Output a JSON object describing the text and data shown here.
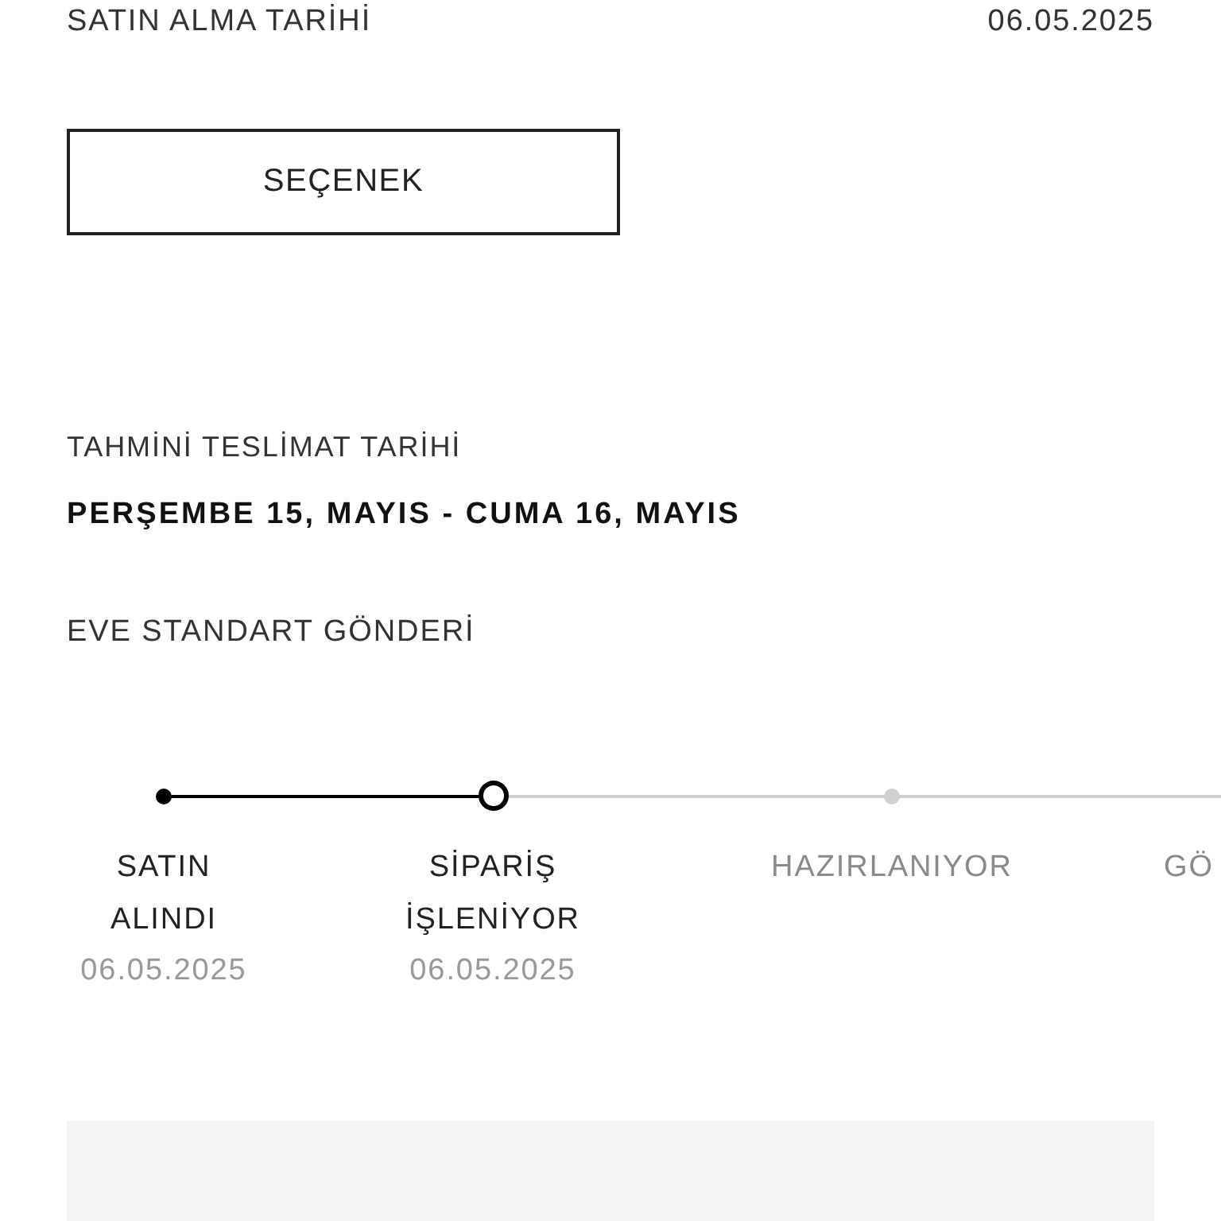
{
  "purchase_date": {
    "label": "SATIN ALMA TARİHİ",
    "value": "06.05.2025"
  },
  "option_button": "SEÇENEK",
  "delivery": {
    "label": "TAHMİNİ TESLİMAT TARİHİ",
    "range": "PERŞEMBE 15, MAYIS - CUMA 16, MAYIS",
    "method": "EVE STANDART GÖNDERİ"
  },
  "steps": [
    {
      "label": "SATIN ALINDI",
      "date": "06.05.2025",
      "completed": true,
      "current": false
    },
    {
      "label": "SİPARİŞ İŞLENİYOR",
      "date": "06.05.2025",
      "completed": true,
      "current": true
    },
    {
      "label": "HAZIRLANIYOR",
      "completed": false,
      "current": false
    },
    {
      "label": "GÖ",
      "completed": false,
      "current": false
    }
  ]
}
